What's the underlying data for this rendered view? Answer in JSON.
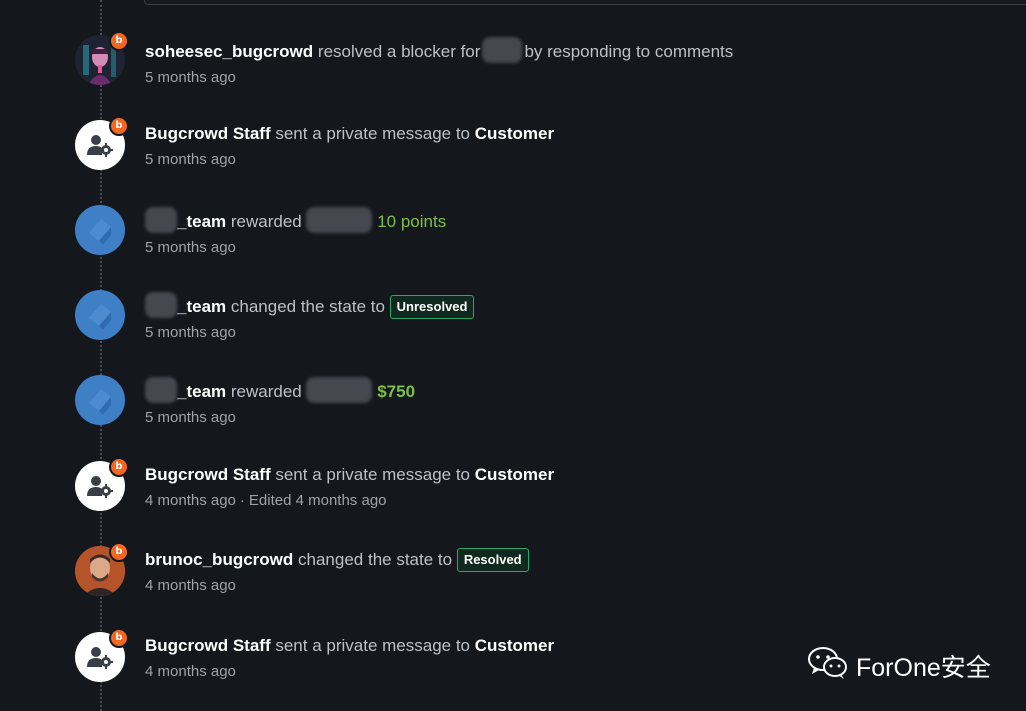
{
  "colors": {
    "background": "#14171c",
    "bugcrowd_orange": "#f26822",
    "reward_green": "#7cc043",
    "state_badge_border": "#2ea36c",
    "team_avatar_blue": "#3f7fc6"
  },
  "activities": [
    {
      "avatar_icon": "researcher-avatar-icon",
      "actor": "soheesec_bugcrowd",
      "action": "resolved a blocker for",
      "action_after": "by responding to comments",
      "time": "5 months ago"
    },
    {
      "avatar_icon": "staff-settings-icon",
      "actor": "Bugcrowd Staff",
      "action": "sent a private message to",
      "target": "Customer",
      "time": "5 months ago"
    },
    {
      "avatar_icon": "team-logo-icon",
      "actor": "_team",
      "action": "rewarded",
      "reward": "10 points",
      "time": "5 months ago"
    },
    {
      "avatar_icon": "team-logo-icon",
      "actor": "_team",
      "action": "changed the state to",
      "state": "Unresolved",
      "time": "5 months ago"
    },
    {
      "avatar_icon": "team-logo-icon",
      "actor": "_team",
      "action": "rewarded",
      "reward": "$750",
      "time": "5 months ago"
    },
    {
      "avatar_icon": "staff-settings-icon",
      "actor": "Bugcrowd Staff",
      "action": "sent a private message to",
      "target": "Customer",
      "time": "4 months ago",
      "separator": "·",
      "edited": "Edited 4 months ago"
    },
    {
      "avatar_icon": "researcher-avatar-icon",
      "actor": "brunoc_bugcrowd",
      "action": "changed the state to",
      "state": "Resolved",
      "time": "4 months ago"
    },
    {
      "avatar_icon": "staff-settings-icon",
      "actor": "Bugcrowd Staff",
      "action": "sent a private message to",
      "target": "Customer",
      "time": "4 months ago"
    }
  ],
  "badge_letter": "b",
  "watermark": {
    "icon": "wechat-icon",
    "text": "ForOne安全"
  }
}
